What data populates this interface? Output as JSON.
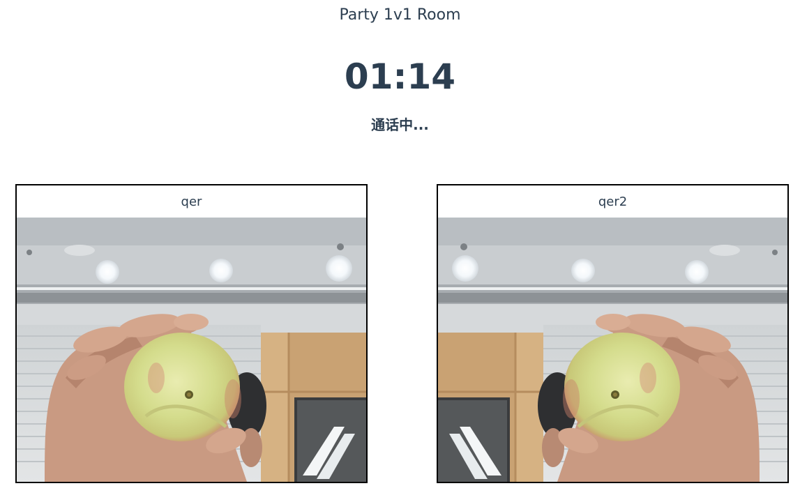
{
  "room": {
    "title": "Party 1v1 Room",
    "timer": "01:14",
    "status": "通话中..."
  },
  "participants": [
    {
      "name": "qer",
      "video_content": "person holding an apple to the camera"
    },
    {
      "name": "qer2",
      "video_content": "person holding an apple to the camera (mirrored)"
    }
  ]
}
